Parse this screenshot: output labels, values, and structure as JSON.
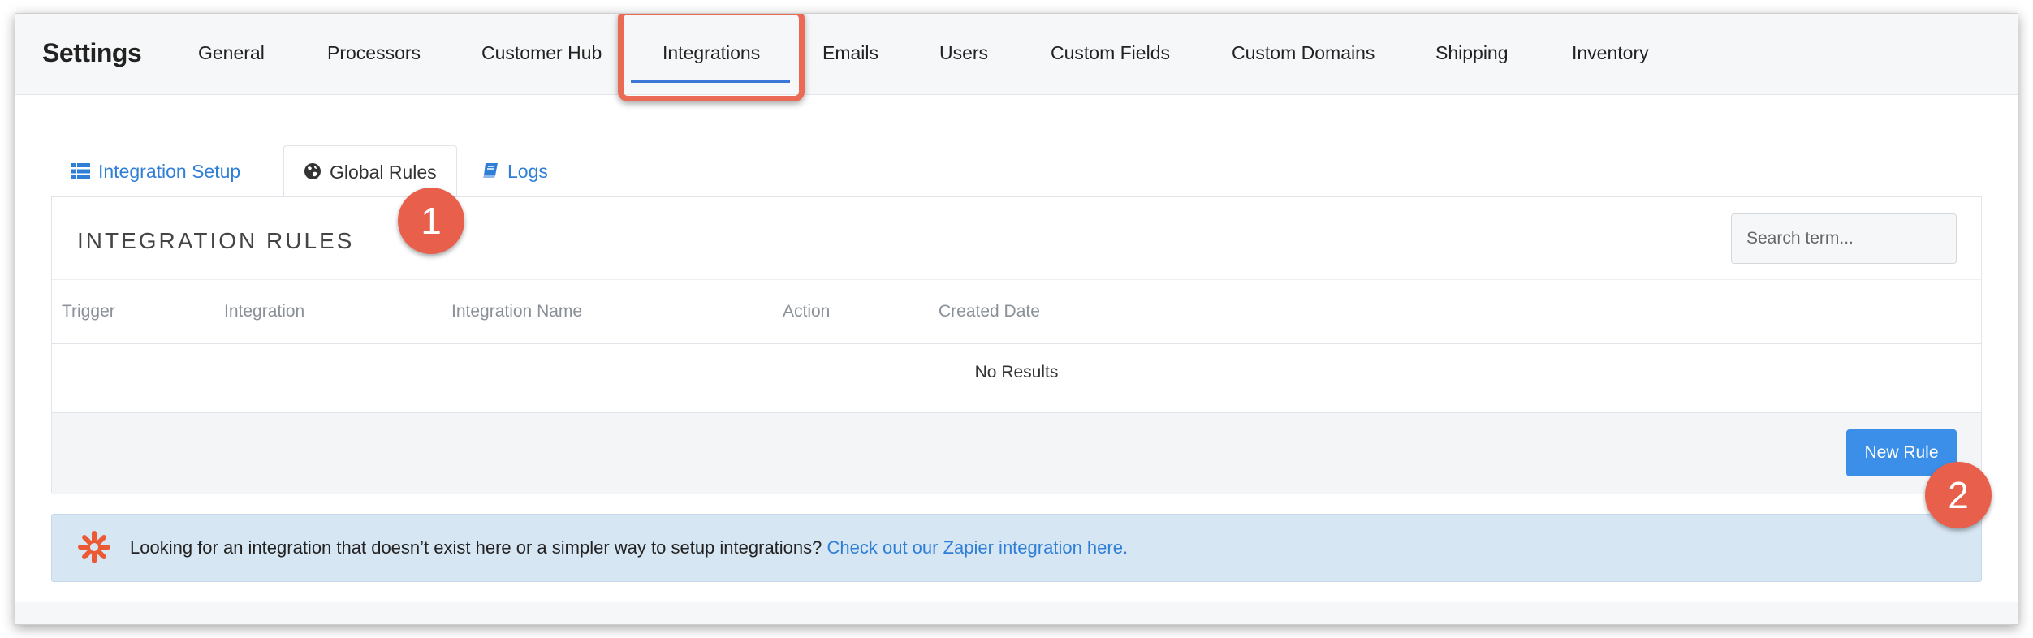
{
  "topbar": {
    "brand": "Settings",
    "nav": [
      {
        "label": "General"
      },
      {
        "label": "Processors"
      },
      {
        "label": "Customer Hub"
      },
      {
        "label": "Integrations",
        "active": true
      },
      {
        "label": "Emails"
      },
      {
        "label": "Users"
      },
      {
        "label": "Custom Fields"
      },
      {
        "label": "Custom Domains"
      },
      {
        "label": "Shipping"
      },
      {
        "label": "Inventory"
      }
    ]
  },
  "tabs": [
    {
      "label": "Integration Setup",
      "icon": "list-icon"
    },
    {
      "label": "Global Rules",
      "icon": "globe-icon",
      "active": true
    },
    {
      "label": "Logs",
      "icon": "book-icon"
    }
  ],
  "panel": {
    "title": "INTEGRATION RULES",
    "search_placeholder": "Search term...",
    "columns": [
      "Trigger",
      "Integration",
      "Integration Name",
      "Action",
      "Created Date"
    ],
    "empty_text": "No Results",
    "new_rule_label": "New Rule"
  },
  "annotations": {
    "badge_1": "1",
    "badge_2": "2"
  },
  "info": {
    "text": "Looking for an integration that doesn’t exist here or a simpler way to setup integrations?",
    "link": "Check out our Zapier integration here.",
    "icon": "zapier-icon"
  },
  "colors": {
    "accent": "#3b8fe8",
    "link": "#2f7fd7",
    "annotation": "#e8604b",
    "info_bg": "#d7e6f3"
  }
}
